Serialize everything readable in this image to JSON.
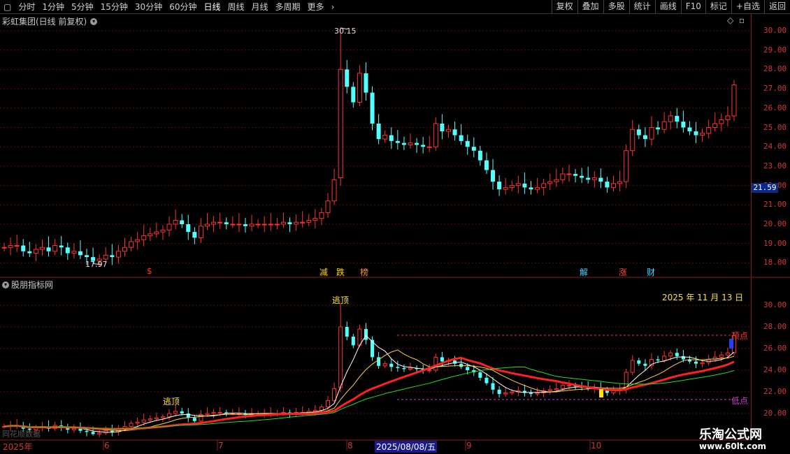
{
  "toolbar": {
    "tabs": [
      "分时",
      "1分钟",
      "5分钟",
      "15分钟",
      "30分钟",
      "60分钟",
      "日线",
      "周线",
      "月线",
      "多周期",
      "更多"
    ],
    "active": "日线",
    "more_icon": "chevron-right-icon",
    "right_buttons": [
      "复权",
      "叠加",
      "多股",
      "统计",
      "画线",
      "F10",
      "标记",
      "+自选",
      "返回"
    ]
  },
  "main_panel": {
    "title": "彩虹集团(日线 前复权)",
    "chevron_icon": "chevron-down-icon",
    "diamond_icon": "diamond-icon",
    "high_label": "30.15",
    "low_label": "17.97",
    "current_price": "21.59",
    "y_ticks": [
      "30.00",
      "29.00",
      "28.00",
      "27.00",
      "26.00",
      "25.00",
      "24.00",
      "23.00",
      "22.00",
      "21.00",
      "20.00",
      "19.00",
      "18.00"
    ],
    "signals": [
      {
        "text": "$",
        "color": "#ff3030"
      },
      {
        "text": "减",
        "color": "#ffd700"
      },
      {
        "text": "跌",
        "color": "#ffd700"
      },
      {
        "text": "榜",
        "color": "#ff9020"
      },
      {
        "text": "解",
        "color": "#40d8ff"
      },
      {
        "text": "涨",
        "color": "#ff4040"
      },
      {
        "text": "财",
        "color": "#40d8ff"
      }
    ]
  },
  "indicator_panel": {
    "title": "股朋指标网",
    "date_label": "2025 年 11 月 13 日",
    "escape_top_labels": [
      "逃顶",
      "逃顶"
    ],
    "top_point_label": "顶点",
    "low_point_label": "低点",
    "bottom_text": "同花顺数据",
    "y_ticks": [
      "30.00",
      "28.00",
      "26.00",
      "24.00",
      "22.00",
      "20.00"
    ]
  },
  "x_axis": {
    "labels": [
      "2025年",
      "6",
      "7",
      "8",
      "2025/08/08/五",
      "9",
      "10"
    ]
  },
  "watermark": {
    "title": "乐淘公式网",
    "url": "www.60lt.com"
  },
  "colors": {
    "up": "#ff3232",
    "down": "#54ffff",
    "axis": "#d03838",
    "grid": "#5a1010"
  },
  "chart_data": {
    "type": "candlestick",
    "x_range": [
      "2025-05",
      "2025-11-13"
    ],
    "y_range": [
      17.5,
      30.5
    ],
    "ohlc_close": [
      18.8,
      18.9,
      18.9,
      18.6,
      18.5,
      18.7,
      18.8,
      18.6,
      18.9,
      18.8,
      18.5,
      18.6,
      18.4,
      18.3,
      18.1,
      18.2,
      18.4,
      18.3,
      18.6,
      18.8,
      19.1,
      19.2,
      19.4,
      19.5,
      19.6,
      19.7,
      20.0,
      20.2,
      20.0,
      19.6,
      19.3,
      19.9,
      20.0,
      20.1,
      20.1,
      20.0,
      20.0,
      20.0,
      19.9,
      20.0,
      20.0,
      20.0,
      20.0,
      20.0,
      20.1,
      20.0,
      20.1,
      20.1,
      20.2,
      20.3,
      20.6,
      21.2,
      22.3,
      28.0,
      27.1,
      26.3,
      27.8,
      26.8,
      25.2,
      24.4,
      24.6,
      24.3,
      24.2,
      24.1,
      24.2,
      24.1,
      24.0,
      24.0,
      25.2,
      24.8,
      24.9,
      24.6,
      24.3,
      24.0,
      23.8,
      23.3,
      22.8,
      22.2,
      21.8,
      21.9,
      22.0,
      22.1,
      21.9,
      21.8,
      21.9,
      22.1,
      22.2,
      22.3,
      22.6,
      22.6,
      22.5,
      22.4,
      22.3,
      22.4,
      22.2,
      21.9,
      22.1,
      22.2,
      23.8,
      24.9,
      24.6,
      24.4,
      25.0,
      24.9,
      25.3,
      25.6,
      25.3,
      25.0,
      24.8,
      24.6,
      24.7,
      25.0,
      25.2,
      25.4,
      25.6,
      27.2
    ]
  }
}
